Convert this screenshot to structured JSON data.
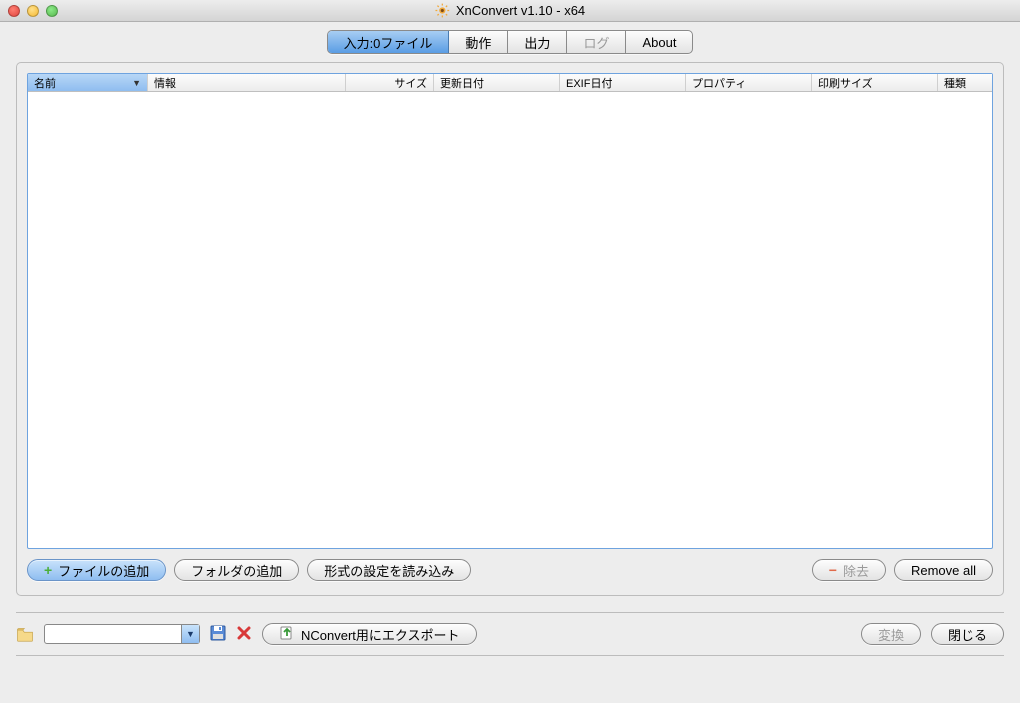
{
  "window": {
    "title": "XnConvert v1.10 - x64"
  },
  "tabs": {
    "input": "入力:0ファイル",
    "action": "動作",
    "output": "出力",
    "log": "ログ",
    "about": "About"
  },
  "columns": {
    "name": "名前",
    "info": "情報",
    "size": "サイズ",
    "modified": "更新日付",
    "exif": "EXIF日付",
    "property": "プロパティ",
    "print": "印刷サイズ",
    "type": "種類"
  },
  "buttons": {
    "add_file": "ファイルの追加",
    "add_folder": "フォルダの追加",
    "load_format": "形式の設定を読み込み",
    "remove": "除去",
    "remove_all": "Remove all",
    "export": "NConvert用にエクスポート",
    "convert": "変換",
    "close": "閉じる"
  }
}
